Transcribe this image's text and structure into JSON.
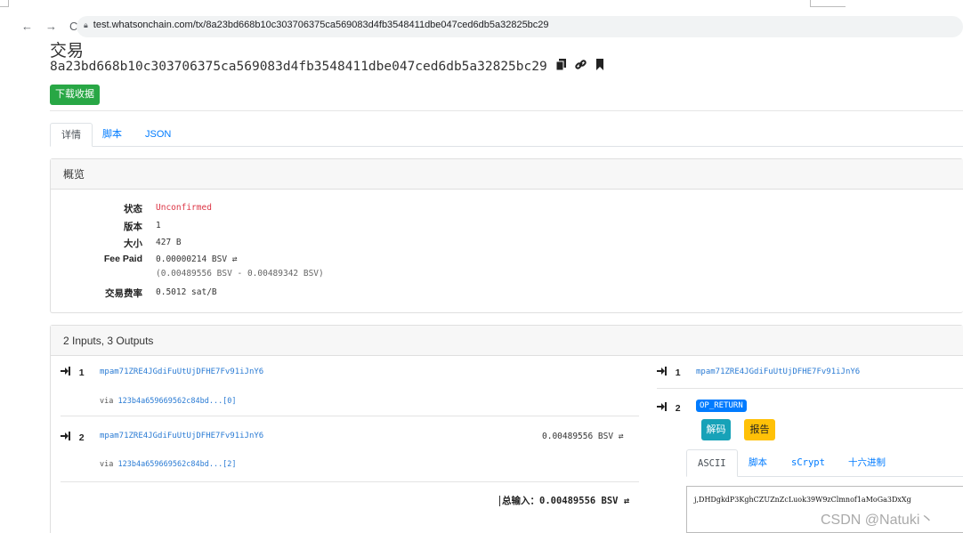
{
  "browser": {
    "back": "←",
    "forward": "→",
    "reload": "C",
    "url": "test.whatsonchain.com/tx/8a23bd668b10c303706375ca569083d4fb3548411dbe047ced6db5a32825bc29"
  },
  "page": {
    "title": "交易",
    "txid": "8a23bd668b10c303706375ca569083d4fb3548411dbe047ced6db5a32825bc29",
    "download_label": "下载收据"
  },
  "tabs": [
    {
      "label": "详情"
    },
    {
      "label": "脚本"
    },
    {
      "label": "JSON"
    }
  ],
  "overview": {
    "header": "概览",
    "rows": [
      {
        "key": "状态",
        "value": "Unconfirmed"
      },
      {
        "key": "版本",
        "value": "1"
      },
      {
        "key": "大小",
        "value": "427 B"
      },
      {
        "key": "Fee Paid",
        "value": "0.00000214 BSV ⇄",
        "sub": "(0.00489556 BSV - 0.00489342 BSV)"
      },
      {
        "key": "交易费率",
        "value": "0.5012 sat/B"
      }
    ]
  },
  "io": {
    "header": "2 Inputs, 3 Outputs",
    "inputs": [
      {
        "num": "1",
        "address": "mpam71ZRE4JGdiFuUtUjDFHE7Fv91iJnY6",
        "via_label": "via",
        "via_link": "123b4a659669562c84bd...[0]",
        "amount": ""
      },
      {
        "num": "2",
        "address": "mpam71ZRE4JGdiFuUtUjDFHE7Fv91iJnY6",
        "via_label": "via",
        "via_link": "123b4a659669562c84bd...[2]",
        "amount": "0.00489556 BSV ⇄"
      }
    ],
    "total_label": "总输入：",
    "total_value": "0.00489556 BSV ⇄",
    "outputs": [
      {
        "num": "1",
        "address": "mpam71ZRE4JGdiFuUtUjDFHE7Fv91iJnY6"
      },
      {
        "num": "2",
        "badge": "OP_RETURN"
      }
    ],
    "decode_label": "解码",
    "report_label": "报告",
    "subtabs": [
      {
        "label": "ASCII"
      },
      {
        "label": "脚本"
      },
      {
        "label": "sCrypt"
      },
      {
        "label": "十六进制"
      }
    ],
    "ascii_content": "j,DHDgkdP3KghCZUZnZcLuok39W9zClmnof1aMoGa3DxXg"
  },
  "watermark": "CSDN @Natuki丶"
}
